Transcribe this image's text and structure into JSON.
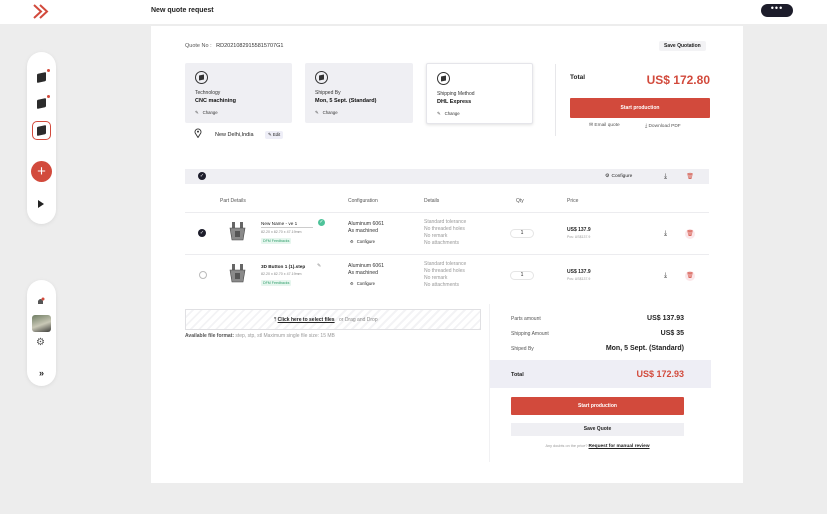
{
  "app": {
    "page_title": "New quote request",
    "chat_icon": "chat-bubble-icon"
  },
  "sidebar": {
    "items": [
      {
        "icon": "part-icon",
        "notify": true
      },
      {
        "icon": "part-icon",
        "notify": true
      },
      {
        "icon": "part-icon",
        "active": true
      }
    ],
    "add_label": "+",
    "lower": {
      "expand_label": "»"
    }
  },
  "quote": {
    "number_label": "Quote No :",
    "number_value": "RD20210829155815707G1",
    "save_label": "Save Quotation"
  },
  "cards": [
    {
      "label": "Technology",
      "value": "CNC machining",
      "change": "Change",
      "icon": "cnc-icon"
    },
    {
      "label": "Shipped By",
      "value": "Mon, 5 Sept. (Standard)",
      "change": "Change",
      "icon": "box-icon"
    },
    {
      "label": "Shipping Method",
      "value": "DHL Express",
      "change": "Change",
      "icon": "truck-icon"
    }
  ],
  "location": {
    "text": "New Delhi,India",
    "edit": "Edit"
  },
  "total": {
    "label": "Total",
    "value": "US$ 172.80",
    "start_label": "Start production",
    "email_label": "Email quote",
    "download_label": "Download PDF"
  },
  "parts": {
    "configure_label": "Configure",
    "columns": [
      "Part Details",
      "Configuration",
      "Details",
      "Qty",
      "Price"
    ],
    "rows": [
      {
        "name": "New Name - ve 1",
        "dims": "82.20 x 82.70 x 47.19mm",
        "dfm": "DFM Feedbacks",
        "material": "Aluminum 6061",
        "finish": "As machined",
        "configure": "Configure",
        "details": [
          "Standard tolerance",
          "No threaded holes",
          "No remark",
          "No attachments"
        ],
        "qty": "1",
        "price": "US$ 137.9",
        "price_sub": "Pcs: US$137.9",
        "checked": true
      },
      {
        "name": "3D Button 1 (1).step",
        "dims": "82.20 x 82.70 x 47.19mm",
        "dfm": "DFM Feedbacks",
        "material": "Aluminum 6061",
        "finish": "As machined",
        "configure": "Configure",
        "details": [
          "Standard tolerance",
          "No threaded holes",
          "No remark",
          "No attachments"
        ],
        "qty": "1",
        "price": "US$ 137.9",
        "price_sub": "Pcs: US$137.9",
        "checked": false
      }
    ]
  },
  "upload": {
    "link": "Click here to select files",
    "rest": "or Drag and Drop",
    "format_label": "Available file format:",
    "format_text": "step, stp, stl  Maximum single file size: 15 MB"
  },
  "summary": {
    "parts_label": "Parts amount",
    "parts_value": "US$ 137.93",
    "shipping_label": "Shipping Amount",
    "shipping_value": "US$ 35",
    "shipped_label": "Shiped By",
    "shipped_value": "Mon, 5 Sept. (Standard)",
    "total_label": "Total",
    "total_value": "US$ 172.93",
    "start_label": "Start production",
    "save_label": "Save Quote",
    "review_prefix": "Any doubts on the price?",
    "review_link": "Request for manual review"
  },
  "colors": {
    "accent": "#d24a3c",
    "dark": "#1d1d2b",
    "success": "#4ec39a"
  }
}
